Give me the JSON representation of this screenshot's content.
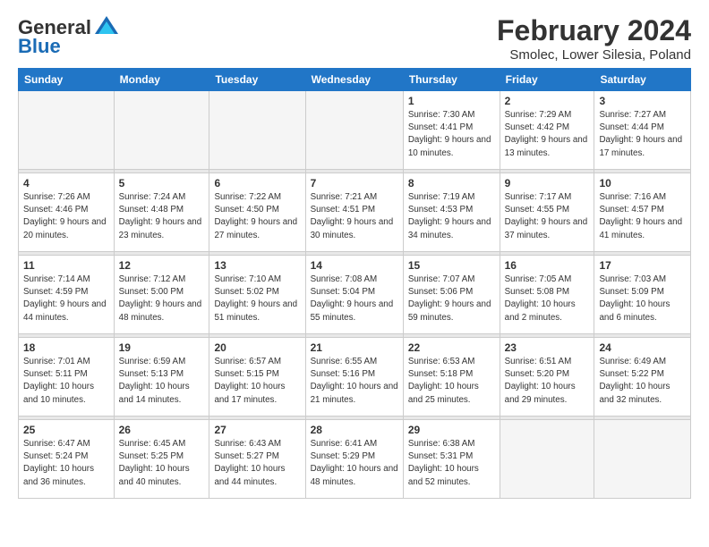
{
  "header": {
    "logo_general": "General",
    "logo_blue": "Blue",
    "month_title": "February 2024",
    "subtitle": "Smolec, Lower Silesia, Poland"
  },
  "weekdays": [
    "Sunday",
    "Monday",
    "Tuesday",
    "Wednesday",
    "Thursday",
    "Friday",
    "Saturday"
  ],
  "weeks": [
    [
      {
        "day": "",
        "empty": true
      },
      {
        "day": "",
        "empty": true
      },
      {
        "day": "",
        "empty": true
      },
      {
        "day": "",
        "empty": true
      },
      {
        "day": "1",
        "sunrise": "7:30 AM",
        "sunset": "4:41 PM",
        "daylight": "9 hours and 10 minutes."
      },
      {
        "day": "2",
        "sunrise": "7:29 AM",
        "sunset": "4:42 PM",
        "daylight": "9 hours and 13 minutes."
      },
      {
        "day": "3",
        "sunrise": "7:27 AM",
        "sunset": "4:44 PM",
        "daylight": "9 hours and 17 minutes."
      }
    ],
    [
      {
        "day": "4",
        "sunrise": "7:26 AM",
        "sunset": "4:46 PM",
        "daylight": "9 hours and 20 minutes."
      },
      {
        "day": "5",
        "sunrise": "7:24 AM",
        "sunset": "4:48 PM",
        "daylight": "9 hours and 23 minutes."
      },
      {
        "day": "6",
        "sunrise": "7:22 AM",
        "sunset": "4:50 PM",
        "daylight": "9 hours and 27 minutes."
      },
      {
        "day": "7",
        "sunrise": "7:21 AM",
        "sunset": "4:51 PM",
        "daylight": "9 hours and 30 minutes."
      },
      {
        "day": "8",
        "sunrise": "7:19 AM",
        "sunset": "4:53 PM",
        "daylight": "9 hours and 34 minutes."
      },
      {
        "day": "9",
        "sunrise": "7:17 AM",
        "sunset": "4:55 PM",
        "daylight": "9 hours and 37 minutes."
      },
      {
        "day": "10",
        "sunrise": "7:16 AM",
        "sunset": "4:57 PM",
        "daylight": "9 hours and 41 minutes."
      }
    ],
    [
      {
        "day": "11",
        "sunrise": "7:14 AM",
        "sunset": "4:59 PM",
        "daylight": "9 hours and 44 minutes."
      },
      {
        "day": "12",
        "sunrise": "7:12 AM",
        "sunset": "5:00 PM",
        "daylight": "9 hours and 48 minutes."
      },
      {
        "day": "13",
        "sunrise": "7:10 AM",
        "sunset": "5:02 PM",
        "daylight": "9 hours and 51 minutes."
      },
      {
        "day": "14",
        "sunrise": "7:08 AM",
        "sunset": "5:04 PM",
        "daylight": "9 hours and 55 minutes."
      },
      {
        "day": "15",
        "sunrise": "7:07 AM",
        "sunset": "5:06 PM",
        "daylight": "9 hours and 59 minutes."
      },
      {
        "day": "16",
        "sunrise": "7:05 AM",
        "sunset": "5:08 PM",
        "daylight": "10 hours and 2 minutes."
      },
      {
        "day": "17",
        "sunrise": "7:03 AM",
        "sunset": "5:09 PM",
        "daylight": "10 hours and 6 minutes."
      }
    ],
    [
      {
        "day": "18",
        "sunrise": "7:01 AM",
        "sunset": "5:11 PM",
        "daylight": "10 hours and 10 minutes."
      },
      {
        "day": "19",
        "sunrise": "6:59 AM",
        "sunset": "5:13 PM",
        "daylight": "10 hours and 14 minutes."
      },
      {
        "day": "20",
        "sunrise": "6:57 AM",
        "sunset": "5:15 PM",
        "daylight": "10 hours and 17 minutes."
      },
      {
        "day": "21",
        "sunrise": "6:55 AM",
        "sunset": "5:16 PM",
        "daylight": "10 hours and 21 minutes."
      },
      {
        "day": "22",
        "sunrise": "6:53 AM",
        "sunset": "5:18 PM",
        "daylight": "10 hours and 25 minutes."
      },
      {
        "day": "23",
        "sunrise": "6:51 AM",
        "sunset": "5:20 PM",
        "daylight": "10 hours and 29 minutes."
      },
      {
        "day": "24",
        "sunrise": "6:49 AM",
        "sunset": "5:22 PM",
        "daylight": "10 hours and 32 minutes."
      }
    ],
    [
      {
        "day": "25",
        "sunrise": "6:47 AM",
        "sunset": "5:24 PM",
        "daylight": "10 hours and 36 minutes."
      },
      {
        "day": "26",
        "sunrise": "6:45 AM",
        "sunset": "5:25 PM",
        "daylight": "10 hours and 40 minutes."
      },
      {
        "day": "27",
        "sunrise": "6:43 AM",
        "sunset": "5:27 PM",
        "daylight": "10 hours and 44 minutes."
      },
      {
        "day": "28",
        "sunrise": "6:41 AM",
        "sunset": "5:29 PM",
        "daylight": "10 hours and 48 minutes."
      },
      {
        "day": "29",
        "sunrise": "6:38 AM",
        "sunset": "5:31 PM",
        "daylight": "10 hours and 52 minutes."
      },
      {
        "day": "",
        "empty": true
      },
      {
        "day": "",
        "empty": true
      }
    ]
  ]
}
